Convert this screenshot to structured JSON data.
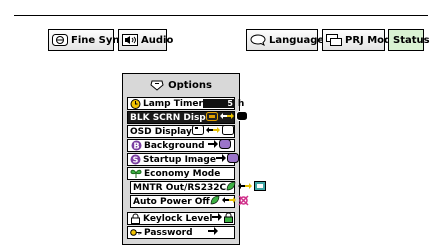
{
  "tabs": [
    {
      "label": "Fine Sync",
      "icon": "fine-sync-icon"
    },
    {
      "label": "Audio",
      "icon": "speaker-icon"
    },
    {
      "label": "Language",
      "icon": "speech-bubble-icon"
    },
    {
      "label": "PRJ Mode",
      "icon": "projector-mode-icon"
    },
    {
      "label": "Status",
      "icon": null
    }
  ],
  "menu": {
    "title": "Options",
    "title_icon": "options-icon",
    "lamp_timer": {
      "label": "Lamp Timer",
      "value": "5",
      "unit": "h"
    },
    "blk_scrn": {
      "label": "BLK SCRN Disp"
    },
    "osd": {
      "label": "OSD Display"
    },
    "background": {
      "label": "Background"
    },
    "startup": {
      "label": "Startup Image"
    },
    "economy": {
      "label": "Economy Mode"
    },
    "mntr": {
      "label": "MNTR Out/RS232C"
    },
    "autopower": {
      "label": "Auto Power Off"
    },
    "keylock": {
      "label": "Keylock Level"
    },
    "password": {
      "label": "Password"
    }
  },
  "colors": {
    "status_bg": "#d9f2d2",
    "panel_bg": "#d8d8d8",
    "selected_row": "#1a1a1a",
    "accent_green": "#3cb043"
  }
}
